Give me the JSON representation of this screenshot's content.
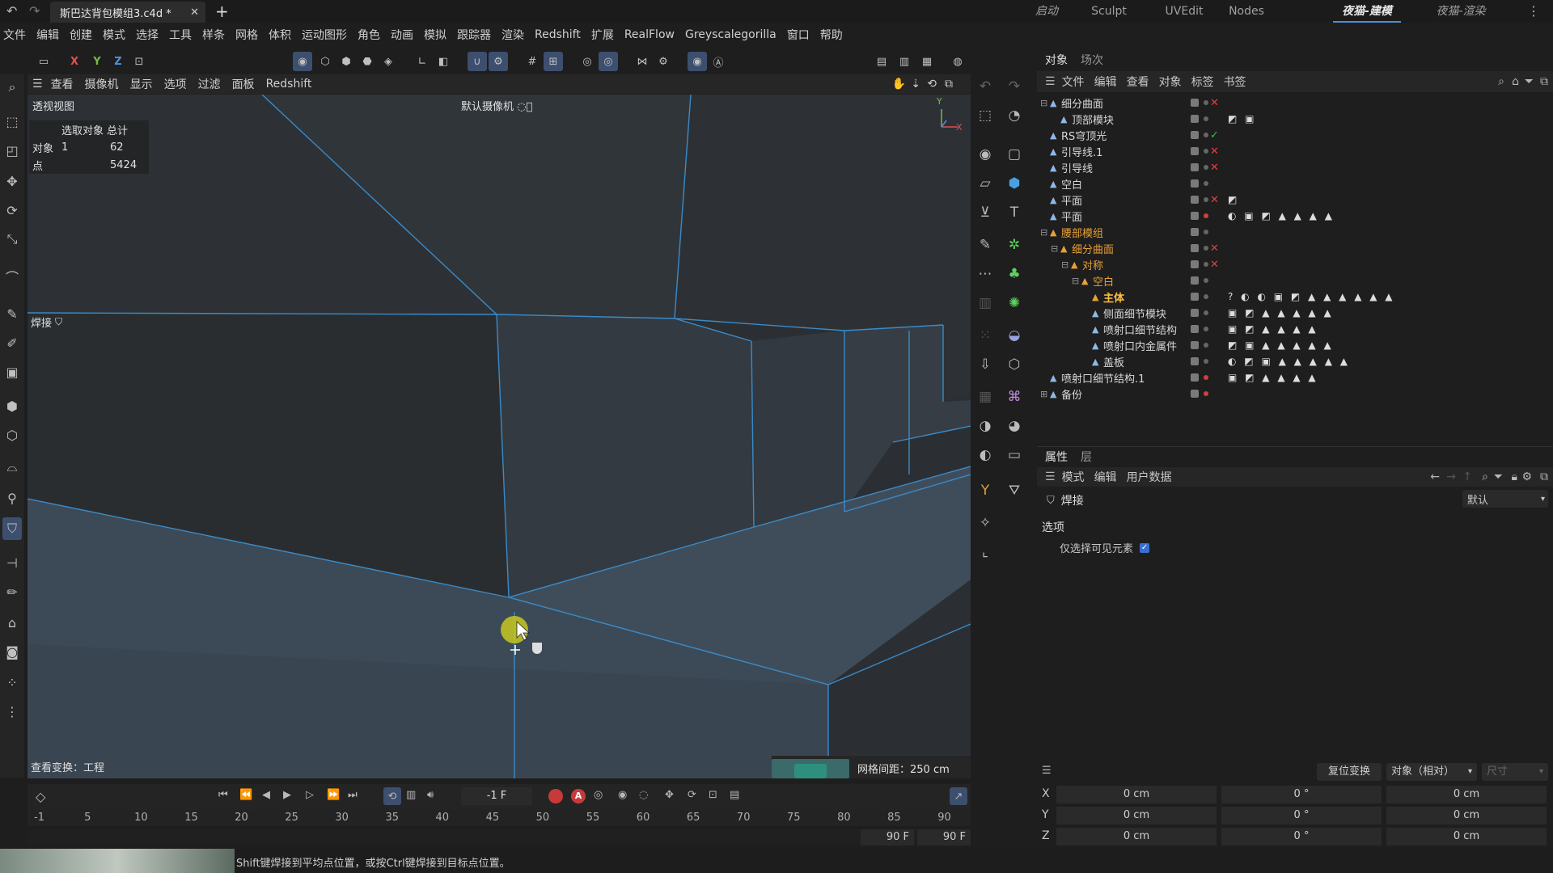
{
  "titlebar": {
    "doc_tab": "斯巴达背包模组3.c4d *",
    "layouts": [
      {
        "label": "启动",
        "active": false,
        "italic": true
      },
      {
        "label": "Sculpt",
        "active": false,
        "italic": false
      },
      {
        "label": "UVEdit",
        "active": false,
        "italic": false
      },
      {
        "label": "Nodes",
        "active": false,
        "italic": false
      },
      {
        "label": "夜猫-建模",
        "active": true,
        "italic": true
      },
      {
        "label": "夜猫-渲染",
        "active": false,
        "italic": true
      }
    ]
  },
  "menubar": [
    "文件",
    "编辑",
    "创建",
    "模式",
    "选择",
    "工具",
    "样条",
    "网格",
    "体积",
    "运动图形",
    "角色",
    "动画",
    "模拟",
    "跟踪器",
    "渲染",
    "Redshift",
    "扩展",
    "RealFlow",
    "Greyscalegorilla",
    "窗口",
    "帮助"
  ],
  "toolbar": {
    "axis_x": "X",
    "axis_y": "Y",
    "axis_z": "Z"
  },
  "viewport": {
    "menu": [
      "查看",
      "摄像机",
      "显示",
      "选项",
      "过滤",
      "面板",
      "Redshift"
    ],
    "view_name": "透视视图",
    "camera": "默认摄像机 ◌⃪",
    "hud": {
      "header_a": "选取对象",
      "header_b": "总计",
      "rows": [
        {
          "label": "对象",
          "selected": "1",
          "total": "62"
        },
        {
          "label": "点",
          "selected": "",
          "total": "5424"
        }
      ]
    },
    "tool_label": "焊接",
    "view_transform": "查看变换：工程",
    "grid_spacing": "网格间距：250 cm"
  },
  "object_manager": {
    "tabs": [
      "对象",
      "场次"
    ],
    "menu": [
      "文件",
      "编辑",
      "查看",
      "对象",
      "标签",
      "书签"
    ],
    "objects": [
      {
        "name": "细分曲面",
        "indent": 0,
        "expand": "⊟",
        "status": "✕",
        "status_color": "#e04040",
        "orange": false,
        "tags": "",
        "dot": "#666"
      },
      {
        "name": "顶部模块",
        "indent": 1,
        "expand": "",
        "status": "",
        "status_color": "",
        "orange": false,
        "tags": "◩ ▣",
        "dot": "#666"
      },
      {
        "name": "RS穹顶光",
        "indent": 0,
        "expand": "",
        "status": "✓",
        "status_color": "#40c040",
        "orange": false,
        "tags": "",
        "dot": "#666"
      },
      {
        "name": "引导线.1",
        "indent": 0,
        "expand": "",
        "status": "✕",
        "status_color": "#e04040",
        "orange": false,
        "tags": "",
        "dot": "#666"
      },
      {
        "name": "引导线",
        "indent": 0,
        "expand": "",
        "status": "✕",
        "status_color": "#e04040",
        "orange": false,
        "tags": "",
        "dot": "#666"
      },
      {
        "name": "空白",
        "indent": 0,
        "expand": "",
        "status": "",
        "status_color": "",
        "orange": false,
        "tags": "",
        "dot": "#666"
      },
      {
        "name": "平面",
        "indent": 0,
        "expand": "",
        "status": "✕",
        "status_color": "#e04040",
        "orange": false,
        "tags": "◩",
        "dot": "#666"
      },
      {
        "name": "平面",
        "indent": 0,
        "expand": "",
        "status": "",
        "status_color": "",
        "orange": false,
        "tags": "◐ ▣ ◩ ▲ ▲ ▲ ▲",
        "dot": "#d04040"
      },
      {
        "name": "腰部模组",
        "indent": 0,
        "expand": "⊟",
        "status": "",
        "status_color": "",
        "orange": true,
        "tags": "",
        "dot": "#666"
      },
      {
        "name": "细分曲面",
        "indent": 1,
        "expand": "⊟",
        "status": "✕",
        "status_color": "#e04040",
        "orange": true,
        "tags": "",
        "dot": "#666"
      },
      {
        "name": "对称",
        "indent": 2,
        "expand": "⊟",
        "status": "✕",
        "status_color": "#e04040",
        "orange": true,
        "tags": "",
        "dot": "#666"
      },
      {
        "name": "空白",
        "indent": 3,
        "expand": "⊟",
        "status": "",
        "status_color": "",
        "orange": true,
        "tags": "",
        "dot": "#666"
      },
      {
        "name": "主体",
        "indent": 4,
        "expand": "",
        "status": "",
        "status_color": "",
        "orange": true,
        "bold": true,
        "tags": "? ◐ ◐ ▣ ◩ ▲ ▲ ▲ ▲ ▲ ▲",
        "dot": "#666"
      },
      {
        "name": "侧面细节模块",
        "indent": 4,
        "expand": "",
        "status": "",
        "status_color": "",
        "orange": false,
        "tags": "▣ ◩ ▲ ▲ ▲ ▲ ▲",
        "dot": "#666"
      },
      {
        "name": "喷射口细节结构",
        "indent": 4,
        "expand": "",
        "status": "",
        "status_color": "",
        "orange": false,
        "tags": "▣ ◩ ▲ ▲ ▲ ▲",
        "dot": "#666"
      },
      {
        "name": "喷射口内金属件",
        "indent": 4,
        "expand": "",
        "status": "",
        "status_color": "",
        "orange": false,
        "tags": "◩ ▣ ▲ ▲ ▲ ▲ ▲",
        "dot": "#666"
      },
      {
        "name": "盖板",
        "indent": 4,
        "expand": "",
        "status": "",
        "status_color": "",
        "orange": false,
        "tags": "◐ ◩ ▣ ▲ ▲ ▲ ▲ ▲",
        "dot": "#666"
      },
      {
        "name": "喷射口细节结构.1",
        "indent": 0,
        "expand": "",
        "status": "",
        "status_color": "",
        "orange": false,
        "tags": "▣ ◩ ▲ ▲ ▲ ▲",
        "dot": "#d04040"
      },
      {
        "name": "备份",
        "indent": 0,
        "expand": "⊞",
        "status": "",
        "status_color": "",
        "orange": false,
        "tags": "",
        "dot": "#d04040"
      }
    ]
  },
  "attributes": {
    "tabs": [
      "属性",
      "层"
    ],
    "menu": [
      "模式",
      "编辑",
      "用户数据"
    ],
    "title": "焊接",
    "preset": "默认",
    "section": "选项",
    "option_label": "仅选择可见元素",
    "option_checked": true
  },
  "coordinates": {
    "reset_button": "复位变换",
    "mode_select": "对象（相对）",
    "size_label": "尺寸",
    "rows": [
      {
        "axis": "X",
        "pos": "0 cm",
        "rot": "0 °",
        "size": "0 cm"
      },
      {
        "axis": "Y",
        "pos": "0 cm",
        "rot": "0 °",
        "size": "0 cm"
      },
      {
        "axis": "Z",
        "pos": "0 cm",
        "rot": "0 °",
        "size": "0 cm"
      }
    ]
  },
  "timeline": {
    "current_frame": "-1 F",
    "ticks": [
      "-1",
      "5",
      "10",
      "15",
      "20",
      "25",
      "30",
      "35",
      "40",
      "45",
      "50",
      "55",
      "60",
      "65",
      "70",
      "75",
      "80",
      "85",
      "90"
    ],
    "end_a": "90 F",
    "end_b": "90 F"
  },
  "status_text": "Shift键焊接到平均点位置，或按Ctrl键焊接到目标点位置。",
  "colors": {
    "accent": "#4a8fd8",
    "orange": "#e8a038",
    "edge": "#3a8bc8",
    "cursor": "#c8c820"
  }
}
